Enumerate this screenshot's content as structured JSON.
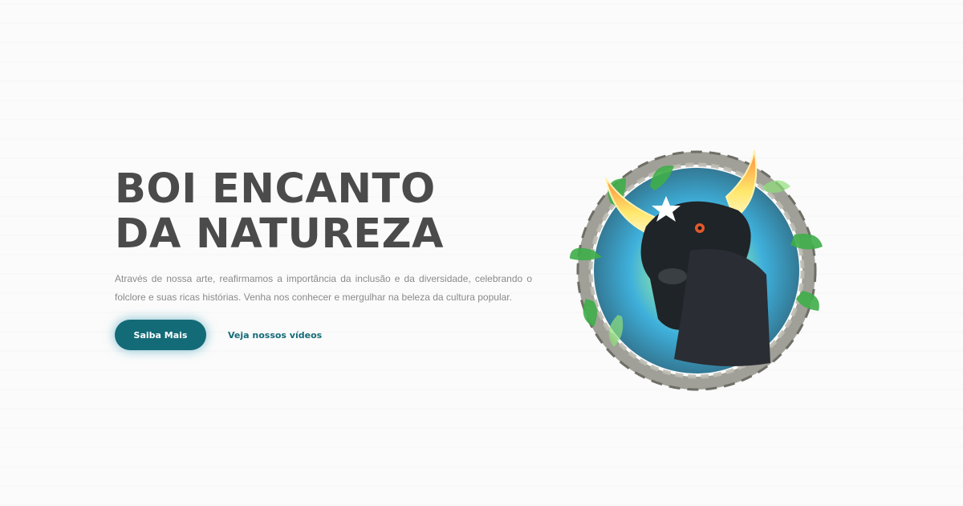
{
  "hero": {
    "title_line1": "BOI ENCANTO",
    "title_line2": "DA NATUREZA",
    "description": "Através de nossa arte, reafirmamos a importância da inclusão e da diversidade, celebrando o folclore e suas ricas histórias. Venha nos conhecer e mergulhar na beleza da cultura popular.",
    "primary_button": "Saiba Mais",
    "secondary_link": "Veja nossos vídeos"
  },
  "colors": {
    "accent": "#146b78",
    "title": "#4b4b4b",
    "body_text": "#8a8a8a",
    "background": "#fbfbfb"
  },
  "illustration": {
    "icon": "bull-emblem-icon"
  }
}
